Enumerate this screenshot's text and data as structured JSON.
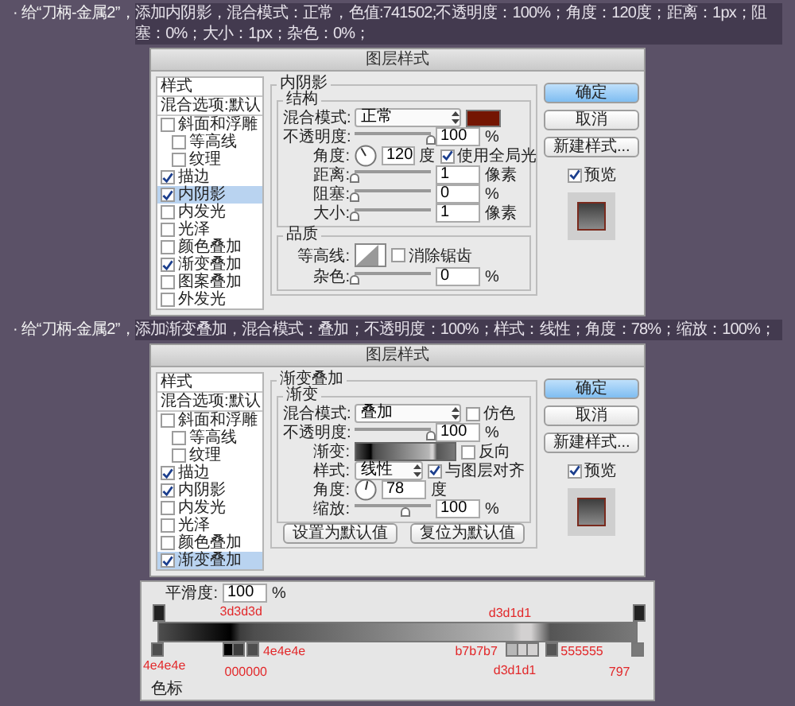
{
  "note_1": {
    "prefix": "· 给“刀柄-金属2”，",
    "highlight": "添加内阴影，混合模式：正常，色值:741502;不透明度：100%；角度：120度；距离：1px；阻塞：0%；大小：1px；杂色：0%；"
  },
  "dialog_1": {
    "title": "图层样式",
    "styles": [
      {
        "label": "样式",
        "kind": "heading",
        "selected": false
      },
      {
        "label": "混合选项:默认",
        "kind": "option",
        "selected": false
      },
      {
        "label": "斜面和浮雕",
        "kind": "effect",
        "checked": false,
        "selected": false,
        "children": [
          {
            "label": "等高线",
            "kind": "effect",
            "checked": false,
            "selected": false
          },
          {
            "label": "纹理",
            "kind": "effect",
            "checked": false,
            "selected": false
          }
        ]
      },
      {
        "label": "描边",
        "kind": "effect",
        "checked": true,
        "selected": false
      },
      {
        "label": "内阴影",
        "kind": "effect",
        "checked": true,
        "selected": true
      },
      {
        "label": "内发光",
        "kind": "effect",
        "checked": false,
        "selected": false
      },
      {
        "label": "光泽",
        "kind": "effect",
        "checked": false,
        "selected": false
      },
      {
        "label": "颜色叠加",
        "kind": "effect",
        "checked": false,
        "selected": false
      },
      {
        "label": "渐变叠加",
        "kind": "effect",
        "checked": true,
        "selected": false
      },
      {
        "label": "图案叠加",
        "kind": "effect",
        "checked": false,
        "selected": false
      },
      {
        "label": "外发光",
        "kind": "effect",
        "checked": false,
        "selected": false
      }
    ],
    "panel": {
      "title": "内阴影",
      "groups": [
        {
          "title": "结构",
          "rows": [
            {
              "kind": "select",
              "label": "混合模式:",
              "value": "正常",
              "color": "#741502"
            },
            {
              "kind": "slider",
              "label": "不透明度:",
              "level": 1,
              "value": "100",
              "unit": "%"
            },
            {
              "kind": "angle",
              "label": "角度:",
              "value": "120",
              "unit": "度",
              "option": {
                "label": "使用全局光",
                "checked": true
              }
            },
            {
              "kind": "slider",
              "label": "距离:",
              "level": 0,
              "value": "1",
              "unit": "像素"
            },
            {
              "kind": "slider",
              "label": "阻塞:",
              "level": 0,
              "value": "0",
              "unit": "%"
            },
            {
              "kind": "slider",
              "label": "大小:",
              "level": 0,
              "value": "1",
              "unit": "像素"
            }
          ]
        },
        {
          "title": "品质",
          "rows": [
            {
              "kind": "contour",
              "label": "等高线:",
              "option": {
                "label": "消除锯齿",
                "checked": false
              }
            },
            {
              "kind": "slider",
              "label": "杂色:",
              "level": 0,
              "value": "0",
              "unit": "%"
            }
          ]
        }
      ]
    },
    "actions": [
      {
        "label": "确定",
        "primary": true
      },
      {
        "label": "取消",
        "primary": false
      },
      {
        "label": "新建样式...",
        "primary": false
      }
    ],
    "preview": {
      "label": "预览",
      "checked": true
    }
  },
  "note_2": {
    "prefix": "· 给“刀柄-金属2”，",
    "highlight": "添加渐变叠加，混合模式：叠加；不透明度：100%；样式：线性；角度：78%；缩放：100%；"
  },
  "dialog_2": {
    "title": "图层样式",
    "styles": [
      {
        "label": "样式",
        "kind": "heading",
        "selected": false
      },
      {
        "label": "混合选项:默认",
        "kind": "option",
        "selected": false
      },
      {
        "label": "斜面和浮雕",
        "kind": "effect",
        "checked": false,
        "selected": false,
        "children": [
          {
            "label": "等高线",
            "kind": "effect",
            "checked": false,
            "selected": false
          },
          {
            "label": "纹理",
            "kind": "effect",
            "checked": false,
            "selected": false
          }
        ]
      },
      {
        "label": "描边",
        "kind": "effect",
        "checked": true,
        "selected": false
      },
      {
        "label": "内阴影",
        "kind": "effect",
        "checked": true,
        "selected": false
      },
      {
        "label": "内发光",
        "kind": "effect",
        "checked": false,
        "selected": false
      },
      {
        "label": "光泽",
        "kind": "effect",
        "checked": false,
        "selected": false
      },
      {
        "label": "颜色叠加",
        "kind": "effect",
        "checked": false,
        "selected": false
      },
      {
        "label": "渐变叠加",
        "kind": "effect",
        "checked": true,
        "selected": true
      }
    ],
    "panel": {
      "title": "渐变叠加",
      "groups": [
        {
          "title": "渐变",
          "rows": [
            {
              "kind": "select",
              "label": "混合模式:",
              "value": "叠加",
              "option": {
                "label": "仿色",
                "checked": false
              }
            },
            {
              "kind": "slider",
              "label": "不透明度:",
              "level": 1,
              "value": "100",
              "unit": "%"
            },
            {
              "kind": "gradient",
              "label": "渐变:",
              "option": {
                "label": "反向",
                "checked": false
              }
            },
            {
              "kind": "select",
              "label": "样式:",
              "value": "线性",
              "option": {
                "label": "与图层对齐",
                "checked": true
              }
            },
            {
              "kind": "angle",
              "label": "角度:",
              "value": "78",
              "unit": "度"
            },
            {
              "kind": "slider",
              "label": "缩放:",
              "level": 0.67,
              "value": "100",
              "unit": "%"
            }
          ]
        }
      ],
      "buttons": [
        "设置为默认值",
        "复位为默认值"
      ]
    },
    "actions": [
      {
        "label": "确定",
        "primary": true
      },
      {
        "label": "取消",
        "primary": false
      },
      {
        "label": "新建样式...",
        "primary": false
      }
    ],
    "preview": {
      "label": "预览",
      "checked": true
    }
  },
  "gradient_editor": {
    "smoothness_label": "平滑度:",
    "smoothness_value": "100",
    "smoothness_unit": "%",
    "stops": [
      {
        "color": "#4e4e4e",
        "label": "4e4e4e"
      },
      {
        "color": "#000000",
        "label": "000000"
      },
      {
        "color": "#3d3d3d",
        "label": "3d3d3d"
      },
      {
        "color": "#4e4e4e",
        "label": "4e4e4e"
      },
      {
        "color": "#b7b7b7",
        "label": "b7b7b7"
      },
      {
        "color": "#d3d1d1",
        "label": "d3d1d1"
      },
      {
        "color": "#d3d1d1",
        "label": "d3d1d1"
      },
      {
        "color": "#555555",
        "label": "555555"
      },
      {
        "color": "#797979",
        "label": "797"
      }
    ],
    "stops_label": "色标"
  }
}
